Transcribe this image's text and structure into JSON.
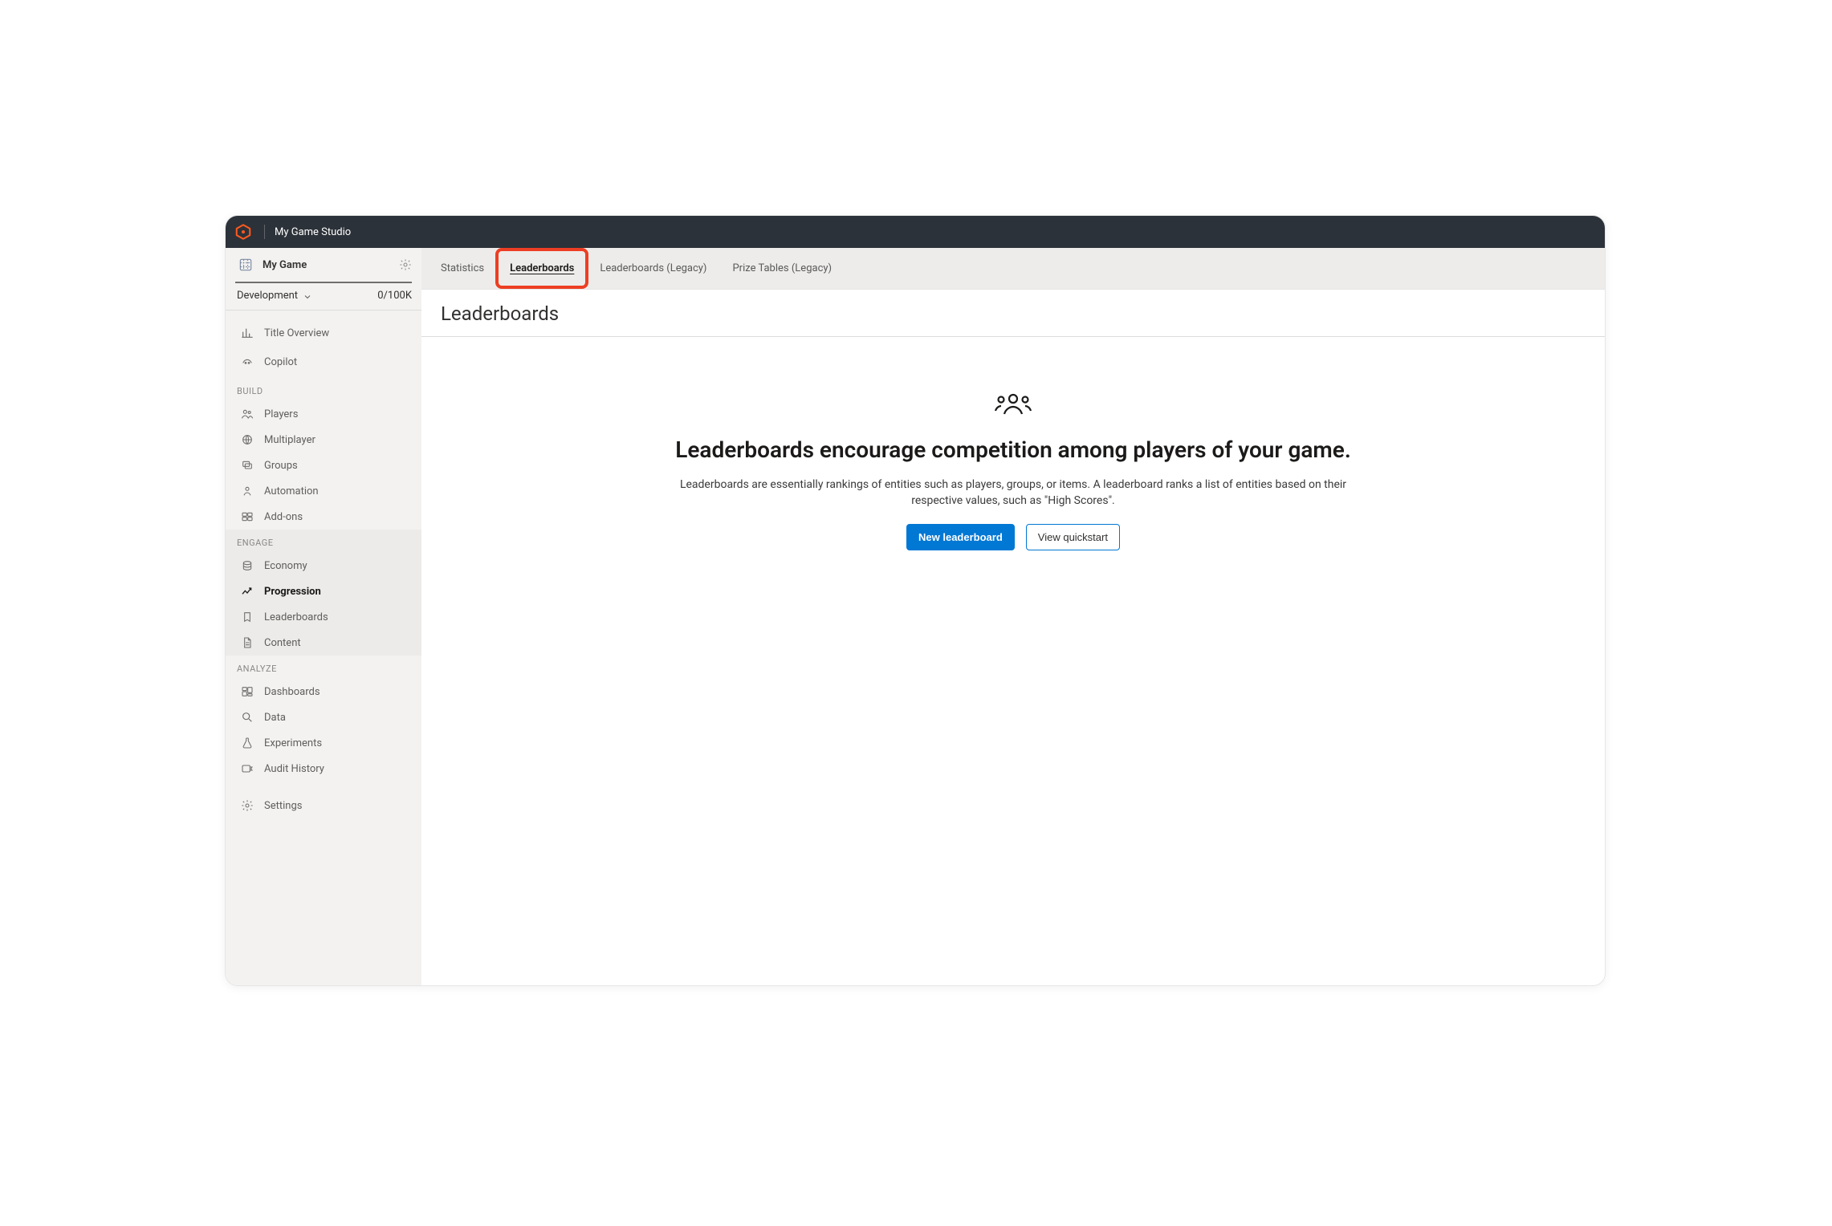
{
  "header": {
    "studio_name": "My Game Studio"
  },
  "sidebar": {
    "game_name": "My Game",
    "environment": "Development",
    "usage": "0/100K",
    "top": [
      {
        "label": "Title Overview"
      },
      {
        "label": "Copilot"
      }
    ],
    "groups": [
      {
        "label": "BUILD",
        "items": [
          {
            "label": "Players"
          },
          {
            "label": "Multiplayer"
          },
          {
            "label": "Groups"
          },
          {
            "label": "Automation"
          },
          {
            "label": "Add-ons"
          }
        ]
      },
      {
        "label": "ENGAGE",
        "items": [
          {
            "label": "Economy"
          },
          {
            "label": "Progression"
          },
          {
            "label": "Leaderboards"
          },
          {
            "label": "Content"
          }
        ]
      },
      {
        "label": "ANALYZE",
        "items": [
          {
            "label": "Dashboards"
          },
          {
            "label": "Data"
          },
          {
            "label": "Experiments"
          },
          {
            "label": "Audit History"
          }
        ]
      }
    ],
    "settings_label": "Settings"
  },
  "tabs": {
    "items": [
      {
        "label": "Statistics"
      },
      {
        "label": "Leaderboards"
      },
      {
        "label": "Leaderboards (Legacy)"
      },
      {
        "label": "Prize Tables (Legacy)"
      }
    ],
    "selected_index": 1
  },
  "page": {
    "title": "Leaderboards",
    "empty": {
      "heading": "Leaderboards encourage competition among players of your game.",
      "description": "Leaderboards are essentially rankings of entities such as players, groups, or items. A leaderboard ranks a list of entities based on their respective values, such as \"High Scores\".",
      "primary_cta": "New leaderboard",
      "secondary_cta": "View quickstart"
    }
  },
  "colors": {
    "accent_blue": "#0078d4",
    "accent_orange": "#ff5a1f",
    "highlight_red": "#ed3e23"
  }
}
